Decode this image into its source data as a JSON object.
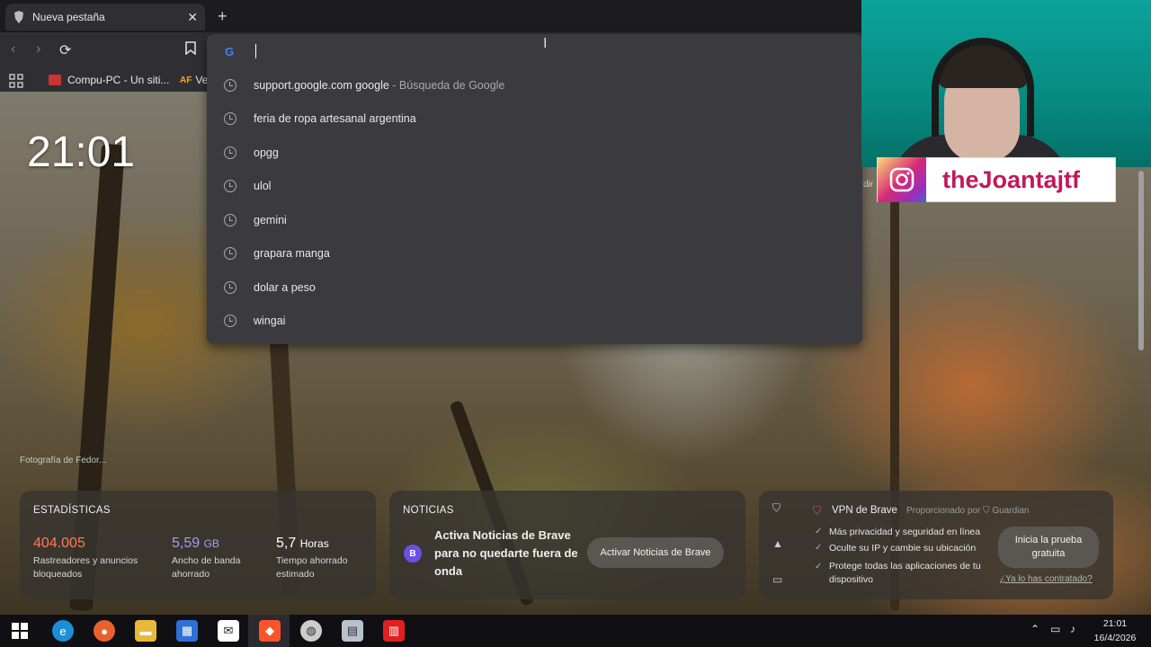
{
  "browser": {
    "tab_title": "Nueva pestaña",
    "new_tab": "+",
    "bookmarks": [
      {
        "label": "Compu-PC - Un siti..."
      },
      {
        "label": "Ve"
      }
    ],
    "omnibox": {
      "provider_glyph": "G",
      "suggestions": [
        {
          "text": "support.google.com google",
          "sub": " - Búsqueda de Google"
        },
        {
          "text": "feria de ropa artesanal argentina",
          "sub": ""
        },
        {
          "text": "opgg",
          "sub": ""
        },
        {
          "text": "ulol",
          "sub": ""
        },
        {
          "text": "gemini",
          "sub": ""
        },
        {
          "text": "grapara manga",
          "sub": ""
        },
        {
          "text": "dolar a peso",
          "sub": ""
        },
        {
          "text": "wingai",
          "sub": ""
        }
      ]
    }
  },
  "newtab": {
    "clock": "21:01",
    "photo_credit": "Fotografía de Fedor...",
    "stats": {
      "title": "ESTADÍSTICAS",
      "trackers_num": "404.005",
      "trackers_label1": "Rastreadores y anuncios",
      "trackers_label2": "bloqueados",
      "bandwidth_num": "5,59",
      "bandwidth_unit": "GB",
      "bandwidth_label1": "Ancho de banda",
      "bandwidth_label2": "ahorrado",
      "time_num": "5,7",
      "time_unit": "Horas",
      "time_label1": "Tiempo ahorrado",
      "time_label2": "estimado"
    },
    "news": {
      "title": "NOTICIAS",
      "badge": "B",
      "text": "Activa Noticias de Brave para no quedarte fuera de onda",
      "button": "Activar Noticias de Brave"
    },
    "vpn": {
      "title": "VPN de Brave",
      "provider": "Proporcionado por",
      "provider_name": "Guardian",
      "line1": "Más privacidad y seguridad en línea",
      "line2": "Oculte su IP y cambie su ubicación",
      "line3a": "Protege todas las aplicaciones de tu",
      "line3b": "dispositivo",
      "cta": "Inicia la prueba gratuita",
      "link": "¿Ya lo has contratado?"
    },
    "partial_text": "dir"
  },
  "overlay": {
    "instagram_handle": "theJoantajtf"
  },
  "taskbar": {
    "time": "21:01",
    "date": "16/4/2026"
  }
}
